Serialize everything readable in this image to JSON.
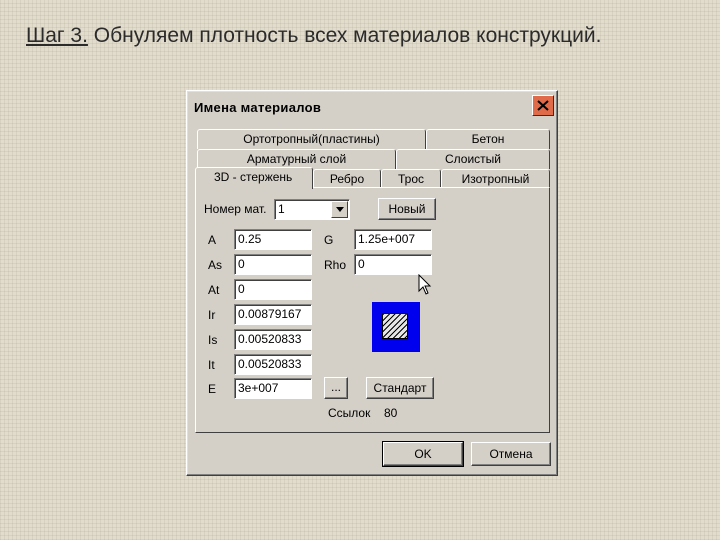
{
  "slide": {
    "step": "Шаг 3.",
    "text": " Обнуляем плотность всех материалов конструкций."
  },
  "dialog": {
    "title": "Имена материалов",
    "tabs_row1": [
      "Ортотропный(пластины)",
      "Бетон"
    ],
    "tabs_row2": [
      "Арматурный слой",
      "Слоистый"
    ],
    "tabs_row3": [
      "3D - стержень",
      "Ребро",
      "Трос",
      "Изотропный"
    ],
    "active_tab": "3D - стержень",
    "material_number": {
      "label": "Номер мат.",
      "value": "1"
    },
    "new_button": "Новый",
    "fields": {
      "A": {
        "label": "A",
        "value": "0.25"
      },
      "As": {
        "label": "As",
        "value": "0"
      },
      "At": {
        "label": "At",
        "value": "0"
      },
      "Ir": {
        "label": "Ir",
        "value": "0.00879167"
      },
      "Is": {
        "label": "Is",
        "value": "0.00520833"
      },
      "It": {
        "label": "It",
        "value": "0.00520833"
      },
      "E": {
        "label": "E",
        "value": "3e+007"
      },
      "G": {
        "label": "G",
        "value": "1.25e+007"
      },
      "Rho": {
        "label": "Rho",
        "value": "0"
      }
    },
    "ellipsis_button": "...",
    "standard_button": "Стандарт",
    "links": {
      "label": "Ссылок",
      "value": "80"
    },
    "ok_button": "OK",
    "cancel_button": "Отмена",
    "colors": {
      "preview_fill": "#0000ee",
      "close_button": "#e06b4a",
      "window_bg": "#d4d0c8"
    }
  }
}
